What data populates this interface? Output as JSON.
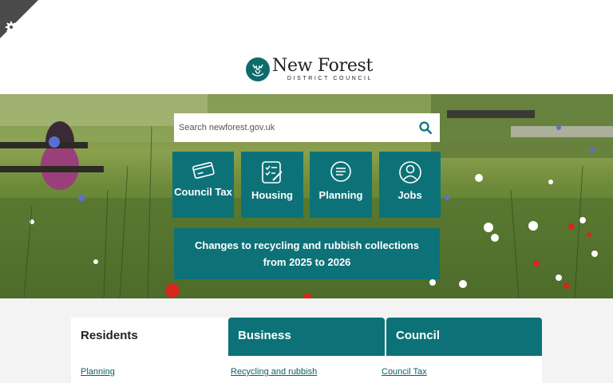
{
  "header": {
    "logo_name": "New Forest",
    "logo_sub": "DISTRICT COUNCIL"
  },
  "search": {
    "placeholder": "Search newforest.gov.uk"
  },
  "tiles": [
    {
      "label": "Council Tax",
      "icon": "card-icon"
    },
    {
      "label": "Housing",
      "icon": "checklist-icon"
    },
    {
      "label": "Planning",
      "icon": "message-icon"
    },
    {
      "label": "Jobs",
      "icon": "person-icon"
    }
  ],
  "banner": {
    "text": "Changes to recycling and rubbish collections from 2025 to 2026"
  },
  "tabs": [
    {
      "label": "Residents",
      "active": true
    },
    {
      "label": "Business",
      "active": false
    },
    {
      "label": "Council",
      "active": false
    }
  ],
  "links": [
    "Planning",
    "Recycling and rubbish",
    "Council Tax"
  ],
  "colors": {
    "brand": "#0d7278",
    "link": "#0d5f66",
    "corner": "#4a4a4a"
  }
}
